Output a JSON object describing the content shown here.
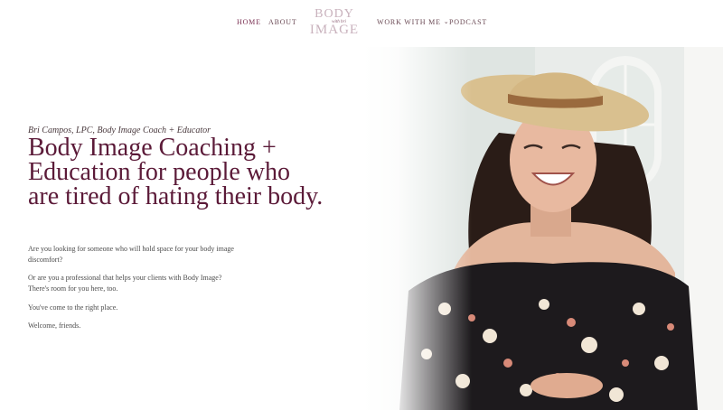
{
  "nav": {
    "items": [
      {
        "label": "HOME",
        "active": true
      },
      {
        "label": "ABOUT",
        "active": false
      },
      {
        "label": "WORK WITH ME",
        "active": false,
        "dropdown": true
      },
      {
        "label": "PODCAST",
        "active": false
      }
    ],
    "logo": {
      "line1": "BODY",
      "line2": "with bri",
      "line3": "IMAGE"
    }
  },
  "hero": {
    "subtitle": "Bri Campos, LPC, Body Image Coach + Educator",
    "headline": "Body Image Coaching + Education for people who are tired of hating their body.",
    "paragraphs": [
      "Are you looking for someone who will hold space for your body image discomfort?",
      "Or are you a professional that helps your clients with Body Image? There's room for you here, too.",
      "You've come to the right place.",
      "Welcome, friends."
    ]
  },
  "icons": {
    "dropdown": "chevron-down-icon"
  },
  "colors": {
    "brand": "#5b1a38",
    "nav_active": "#7a2f52",
    "logo": "#c9b2bd",
    "body_text": "#4b4b4b"
  }
}
